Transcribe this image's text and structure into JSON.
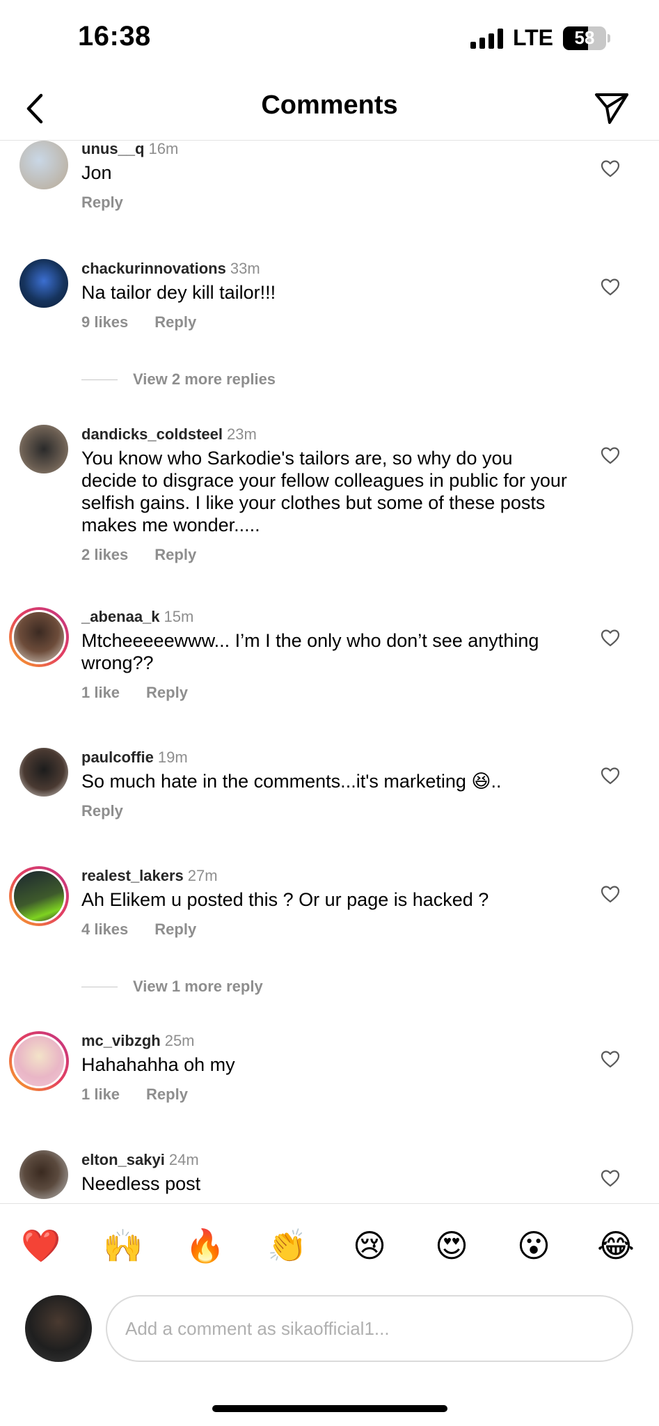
{
  "status_bar": {
    "time": "16:38",
    "network": "LTE",
    "battery": "58",
    "battery_level": 0.58
  },
  "header": {
    "title": "Comments",
    "back_icon": "chevron-left-icon",
    "share_icon": "paper-plane-icon"
  },
  "comments": [
    {
      "username": "unus__q",
      "time": "16m",
      "text": "Jon",
      "likes": "",
      "reply": "Reply"
    },
    {
      "username": "chackurinnovations",
      "time": "33m",
      "text": "Na tailor dey kill tailor!!!",
      "likes": "9 likes",
      "reply": "Reply"
    },
    {
      "username": "dandicks_coldsteel",
      "time": "23m",
      "text": "You know who Sarkodie's tailors are, so why do you decide to disgrace your fellow colleagues in public for your selfish gains. I like your clothes but some of these posts makes me wonder.....",
      "likes": "2 likes",
      "reply": "Reply"
    },
    {
      "username": "_abenaa_k",
      "time": "15m",
      "text": "Mtcheeeeewww... I’m I the only who don’t see anything wrong??",
      "likes": "1 like",
      "reply": "Reply"
    },
    {
      "username": "paulcoffie",
      "time": "19m",
      "text": "So much hate in the comments...it's marketing 😆..",
      "likes": "",
      "reply": "Reply"
    },
    {
      "username": "realest_lakers",
      "time": "27m",
      "text": "Ah Elikem u posted this ? Or ur page is hacked ?",
      "likes": "4 likes",
      "reply": "Reply"
    },
    {
      "username": "mc_vibzgh",
      "time": "25m",
      "text": "Hahahahha oh my",
      "likes": "1 like",
      "reply": "Reply"
    },
    {
      "username": "elton_sakyi",
      "time": "24m",
      "text": "Needless post",
      "likes": "",
      "reply": ""
    }
  ],
  "view_replies": [
    "View 2 more replies",
    "View 1 more reply"
  ],
  "quick_reactions": [
    "❤️",
    "🙌",
    "🔥",
    "👏",
    "😢",
    "😍",
    "😮",
    "😂"
  ],
  "composer": {
    "placeholder": "Add a comment as sikaofficial1..."
  },
  "colors": {
    "secondary_text": "#8e8e8e",
    "story_ring": "#e4405f",
    "divider": "#e3e3e3"
  }
}
